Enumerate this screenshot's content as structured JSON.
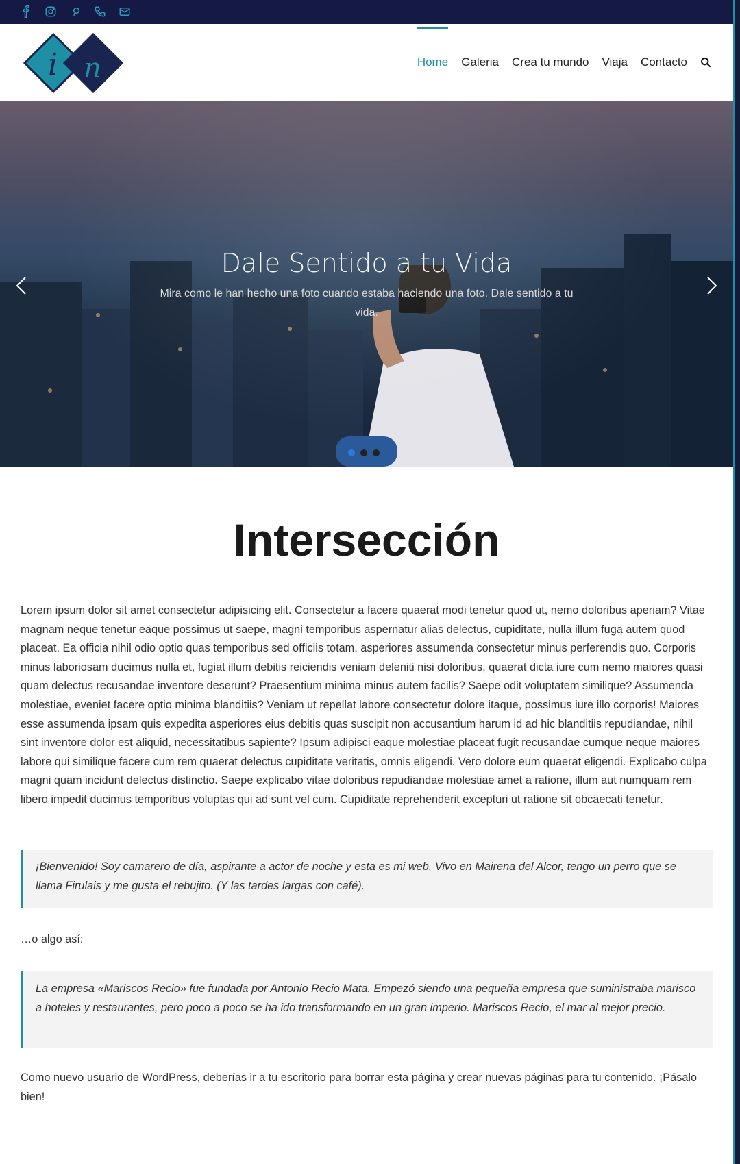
{
  "social": [
    {
      "icon": "facebook-icon"
    },
    {
      "icon": "instagram-icon"
    },
    {
      "icon": "pinterest-icon"
    },
    {
      "icon": "phone-icon"
    },
    {
      "icon": "mail-icon"
    }
  ],
  "logo": {
    "letters": "i n"
  },
  "nav": {
    "items": [
      {
        "label": "Home",
        "active": true
      },
      {
        "label": "Galeria"
      },
      {
        "label": "Crea tu mundo"
      },
      {
        "label": "Viaja"
      },
      {
        "label": "Contacto"
      }
    ],
    "search_icon": "search-icon"
  },
  "hero": {
    "title": "Dale Sentido a tu Vida",
    "subtitle": "Mira como le han hecho una foto cuando estaba haciendo una foto. Dale sentido a tu vida.",
    "slides": 3,
    "active_slide": 1
  },
  "main": {
    "title": "Intersección",
    "lorem": "Lorem ipsum dolor sit amet consectetur adipisicing elit. Consectetur a facere quaerat modi tenetur quod ut, nemo doloribus aperiam? Vitae magnam neque tenetur eaque possimus ut saepe, magni temporibus aspernatur alias delectus, cupiditate, nulla illum fuga autem quod placeat. Ea officia nihil odio optio quas temporibus sed officiis totam, asperiores assumenda consectetur minus perferendis quo. Corporis minus laboriosam ducimus nulla et, fugiat illum debitis reiciendis veniam deleniti nisi doloribus, quaerat dicta iure cum nemo maiores quasi quam delectus recusandae inventore deserunt? Praesentium minima minus autem facilis? Saepe odit voluptatem similique? Assumenda molestiae, eveniet facere optio minima blanditiis? Veniam ut repellat labore consectetur dolore itaque, possimus iure illo corporis! Maiores esse assumenda ipsam quis expedita asperiores eius debitis quas suscipit non accusantium harum id ad hic blanditiis repudiandae, nihil sint inventore dolor est aliquid, necessitatibus sapiente? Ipsum adipisci eaque molestiae placeat fugit recusandae cumque neque maiores labore qui similique facere cum rem quaerat delectus cupiditate veritatis, omnis eligendi. Vero dolore eum quaerat eligendi. Explicabo culpa magni quam incidunt delectus distinctio. Saepe explicabo vitae doloribus repudiandae molestiae amet a ratione, illum aut numquam rem libero impedit ducimus temporibus voluptas qui ad sunt vel cum. Cupiditate reprehenderit excepturi ut ratione sit obcaecati tenetur.",
    "quote1": "¡Bienvenido! Soy camarero de día, aspirante a actor de noche y esta es mi web. Vivo en Mairena del Alcor, tengo un perro que se llama Firulais y me gusta el rebujito. (Y las tardes largas con café).",
    "o_algo": "…o algo así:",
    "quote2": "La empresa «Mariscos Recio» fue fundada por Antonio Recio Mata. Empezó siendo una pequeña empresa que suministraba marisco a hoteles y restaurantes, pero poco a poco se ha ido transformando en un gran imperio. Mariscos Recio, el mar al mejor precio.",
    "final": "Como nuevo usuario de WordPress, deberías ir a tu escritorio para borrar esta página y crear nuevas páginas para tu contenido. ¡Pásalo bien!"
  },
  "colors": {
    "accent": "#1f8fa6",
    "topbar": "#151a44",
    "logo_dark": "#1a2450",
    "logo_teal": "#1f8fa6"
  }
}
